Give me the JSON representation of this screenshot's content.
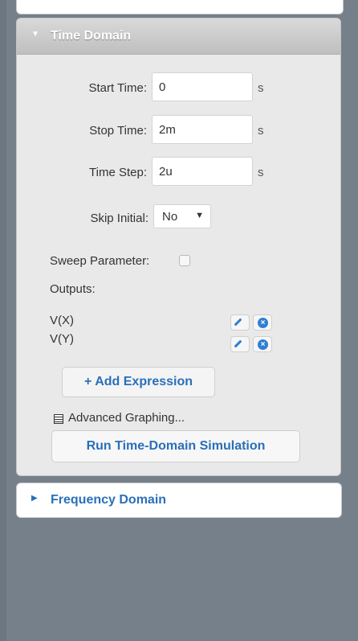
{
  "time_domain": {
    "title": "Time Domain",
    "start_time": {
      "label": "Start Time:",
      "value": "0",
      "unit": "s"
    },
    "stop_time": {
      "label": "Stop Time:",
      "value": "2m",
      "unit": "s"
    },
    "time_step": {
      "label": "Time Step:",
      "value": "2u",
      "unit": "s"
    },
    "skip_initial": {
      "label": "Skip Initial:",
      "value": "No"
    },
    "sweep_parameter": {
      "label": "Sweep Parameter:"
    },
    "outputs_label": "Outputs:",
    "outputs": [
      {
        "name": "V(X)"
      },
      {
        "name": "V(Y)"
      }
    ],
    "add_expression_label": "+ Add Expression",
    "advanced_graphing_label": "Advanced Graphing...",
    "run_button_label": "Run Time-Domain Simulation"
  },
  "frequency_domain": {
    "title": "Frequency Domain"
  },
  "colors": {
    "accent": "#2a6fb8",
    "background": "#75808a"
  }
}
